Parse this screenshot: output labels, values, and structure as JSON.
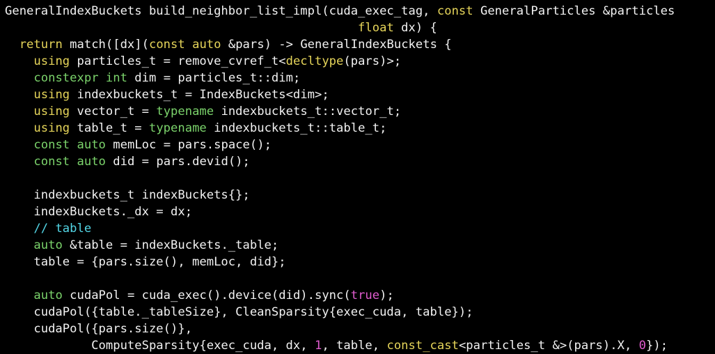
{
  "colors": {
    "background": "#000000",
    "text": "#f2f2f2",
    "keyword": "#e6d55a",
    "type": "#7bd36b",
    "number": "#e05ccf",
    "comment": "#53d6e6"
  },
  "lines": [
    [
      [
        "plain",
        "GeneralIndexBuckets build_neighbor_list_impl(cuda_exec_tag, "
      ],
      [
        "kw",
        "const"
      ],
      [
        "plain",
        " GeneralParticles &particles"
      ]
    ],
    [
      [
        "plain",
        "                                                 "
      ],
      [
        "kw",
        "float"
      ],
      [
        "plain",
        " dx) {"
      ]
    ],
    [
      [
        "plain",
        "  "
      ],
      [
        "kw",
        "return"
      ],
      [
        "plain",
        " match([dx]("
      ],
      [
        "kw",
        "const"
      ],
      [
        "plain",
        " "
      ],
      [
        "kw",
        "auto"
      ],
      [
        "plain",
        " &pars) -> GeneralIndexBuckets {"
      ]
    ],
    [
      [
        "plain",
        "    "
      ],
      [
        "kw",
        "using"
      ],
      [
        "plain",
        " particles_t = remove_cvref_t<"
      ],
      [
        "kw",
        "decltype"
      ],
      [
        "plain",
        "(pars)>;"
      ]
    ],
    [
      [
        "plain",
        "    "
      ],
      [
        "type",
        "constexpr"
      ],
      [
        "plain",
        " "
      ],
      [
        "type",
        "int"
      ],
      [
        "plain",
        " dim = particles_t::dim;"
      ]
    ],
    [
      [
        "plain",
        "    "
      ],
      [
        "kw",
        "using"
      ],
      [
        "plain",
        " indexbuckets_t = IndexBuckets<dim>;"
      ]
    ],
    [
      [
        "plain",
        "    "
      ],
      [
        "kw",
        "using"
      ],
      [
        "plain",
        " vector_t = "
      ],
      [
        "type",
        "typename"
      ],
      [
        "plain",
        " indexbuckets_t::vector_t;"
      ]
    ],
    [
      [
        "plain",
        "    "
      ],
      [
        "kw",
        "using"
      ],
      [
        "plain",
        " table_t = "
      ],
      [
        "type",
        "typename"
      ],
      [
        "plain",
        " indexbuckets_t::table_t;"
      ]
    ],
    [
      [
        "plain",
        "    "
      ],
      [
        "type",
        "const"
      ],
      [
        "plain",
        " "
      ],
      [
        "type",
        "auto"
      ],
      [
        "plain",
        " memLoc = pars.space();"
      ]
    ],
    [
      [
        "plain",
        "    "
      ],
      [
        "type",
        "const"
      ],
      [
        "plain",
        " "
      ],
      [
        "type",
        "auto"
      ],
      [
        "plain",
        " did = pars.devid();"
      ]
    ],
    [
      [
        "plain",
        ""
      ]
    ],
    [
      [
        "plain",
        "    indexbuckets_t indexBuckets{};"
      ]
    ],
    [
      [
        "plain",
        "    indexBuckets._dx = dx;"
      ]
    ],
    [
      [
        "plain",
        "    "
      ],
      [
        "cm",
        "// table"
      ]
    ],
    [
      [
        "plain",
        "    "
      ],
      [
        "type",
        "auto"
      ],
      [
        "plain",
        " &table = indexBuckets._table;"
      ]
    ],
    [
      [
        "plain",
        "    table = {pars.size(), memLoc, did};"
      ]
    ],
    [
      [
        "plain",
        ""
      ]
    ],
    [
      [
        "plain",
        "    "
      ],
      [
        "type",
        "auto"
      ],
      [
        "plain",
        " cudaPol = cuda_exec().device(did).sync("
      ],
      [
        "num",
        "true"
      ],
      [
        "plain",
        ");"
      ]
    ],
    [
      [
        "plain",
        "    cudaPol({table._tableSize}, CleanSparsity{exec_cuda, table});"
      ]
    ],
    [
      [
        "plain",
        "    cudaPol({pars.size()},"
      ]
    ],
    [
      [
        "plain",
        "            ComputeSparsity{exec_cuda, dx, "
      ],
      [
        "num",
        "1"
      ],
      [
        "plain",
        ", table, "
      ],
      [
        "kw",
        "const_cast"
      ],
      [
        "plain",
        "<particles_t &>(pars).X, "
      ],
      [
        "num",
        "0"
      ],
      [
        "plain",
        "});"
      ]
    ]
  ]
}
